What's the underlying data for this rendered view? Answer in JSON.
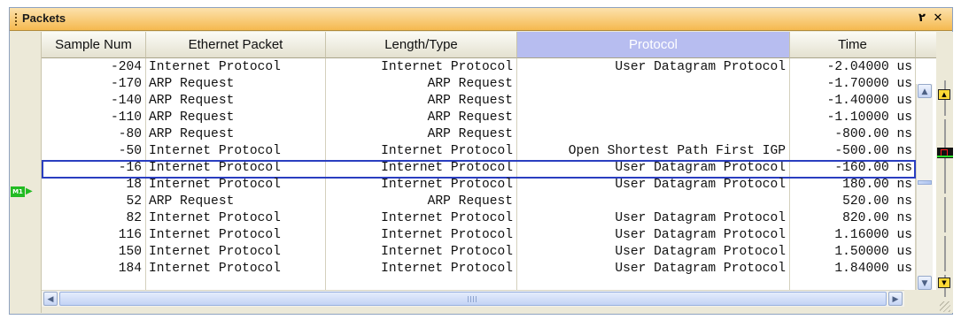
{
  "panel": {
    "title": "Packets",
    "pin_glyph": "٢",
    "close_glyph": "✕"
  },
  "marker": {
    "label": "M1",
    "arrow": "▶"
  },
  "columns": [
    {
      "label": "Sample Num",
      "selected": false
    },
    {
      "label": "Ethernet Packet",
      "selected": false
    },
    {
      "label": "Length/Type",
      "selected": false
    },
    {
      "label": "Protocol",
      "selected": true
    },
    {
      "label": "Time",
      "selected": false
    }
  ],
  "rows": [
    {
      "sample": "-204",
      "eth": "Internet Protocol",
      "len": "Internet Protocol",
      "proto": "User Datagram Protocol",
      "time": "-2.04000 us"
    },
    {
      "sample": "-170",
      "eth": "ARP Request",
      "len": "ARP Request",
      "proto": "",
      "time": "-1.70000 us"
    },
    {
      "sample": "-140",
      "eth": "ARP Request",
      "len": "ARP Request",
      "proto": "",
      "time": "-1.40000 us"
    },
    {
      "sample": "-110",
      "eth": "ARP Request",
      "len": "ARP Request",
      "proto": "",
      "time": "-1.10000 us"
    },
    {
      "sample": "-80",
      "eth": "ARP Request",
      "len": "ARP Request",
      "proto": "",
      "time": "-800.00 ns"
    },
    {
      "sample": "-50",
      "eth": "Internet Protocol",
      "len": "Internet Protocol",
      "proto": "Open Shortest Path First IGP",
      "time": "-500.00 ns"
    },
    {
      "sample": "-16",
      "eth": "Internet Protocol",
      "len": "Internet Protocol",
      "proto": "User Datagram Protocol",
      "time": "-160.00 ns"
    },
    {
      "sample": "18",
      "eth": "Internet Protocol",
      "len": "Internet Protocol",
      "proto": "User Datagram Protocol",
      "time": "180.00 ns"
    },
    {
      "sample": "52",
      "eth": "ARP Request",
      "len": "ARP Request",
      "proto": "",
      "time": "520.00 ns"
    },
    {
      "sample": "82",
      "eth": "Internet Protocol",
      "len": "Internet Protocol",
      "proto": "User Datagram Protocol",
      "time": "820.00 ns"
    },
    {
      "sample": "116",
      "eth": "Internet Protocol",
      "len": "Internet Protocol",
      "proto": "User Datagram Protocol",
      "time": "1.16000 us"
    },
    {
      "sample": "150",
      "eth": "Internet Protocol",
      "len": "Internet Protocol",
      "proto": "User Datagram Protocol",
      "time": "1.50000 us"
    },
    {
      "sample": "184",
      "eth": "Internet Protocol",
      "len": "Internet Protocol",
      "proto": "User Datagram Protocol",
      "time": "1.84000 us"
    }
  ],
  "selected_row": 6,
  "scrollbars": {
    "up": "▲",
    "down": "▼",
    "left": "◀",
    "right": "▶"
  },
  "colors": {
    "title_bar": "#f5b94f",
    "selected_header": "#b7bdf0",
    "selection_border": "#2a3ec0",
    "marker": "#22bb22"
  }
}
